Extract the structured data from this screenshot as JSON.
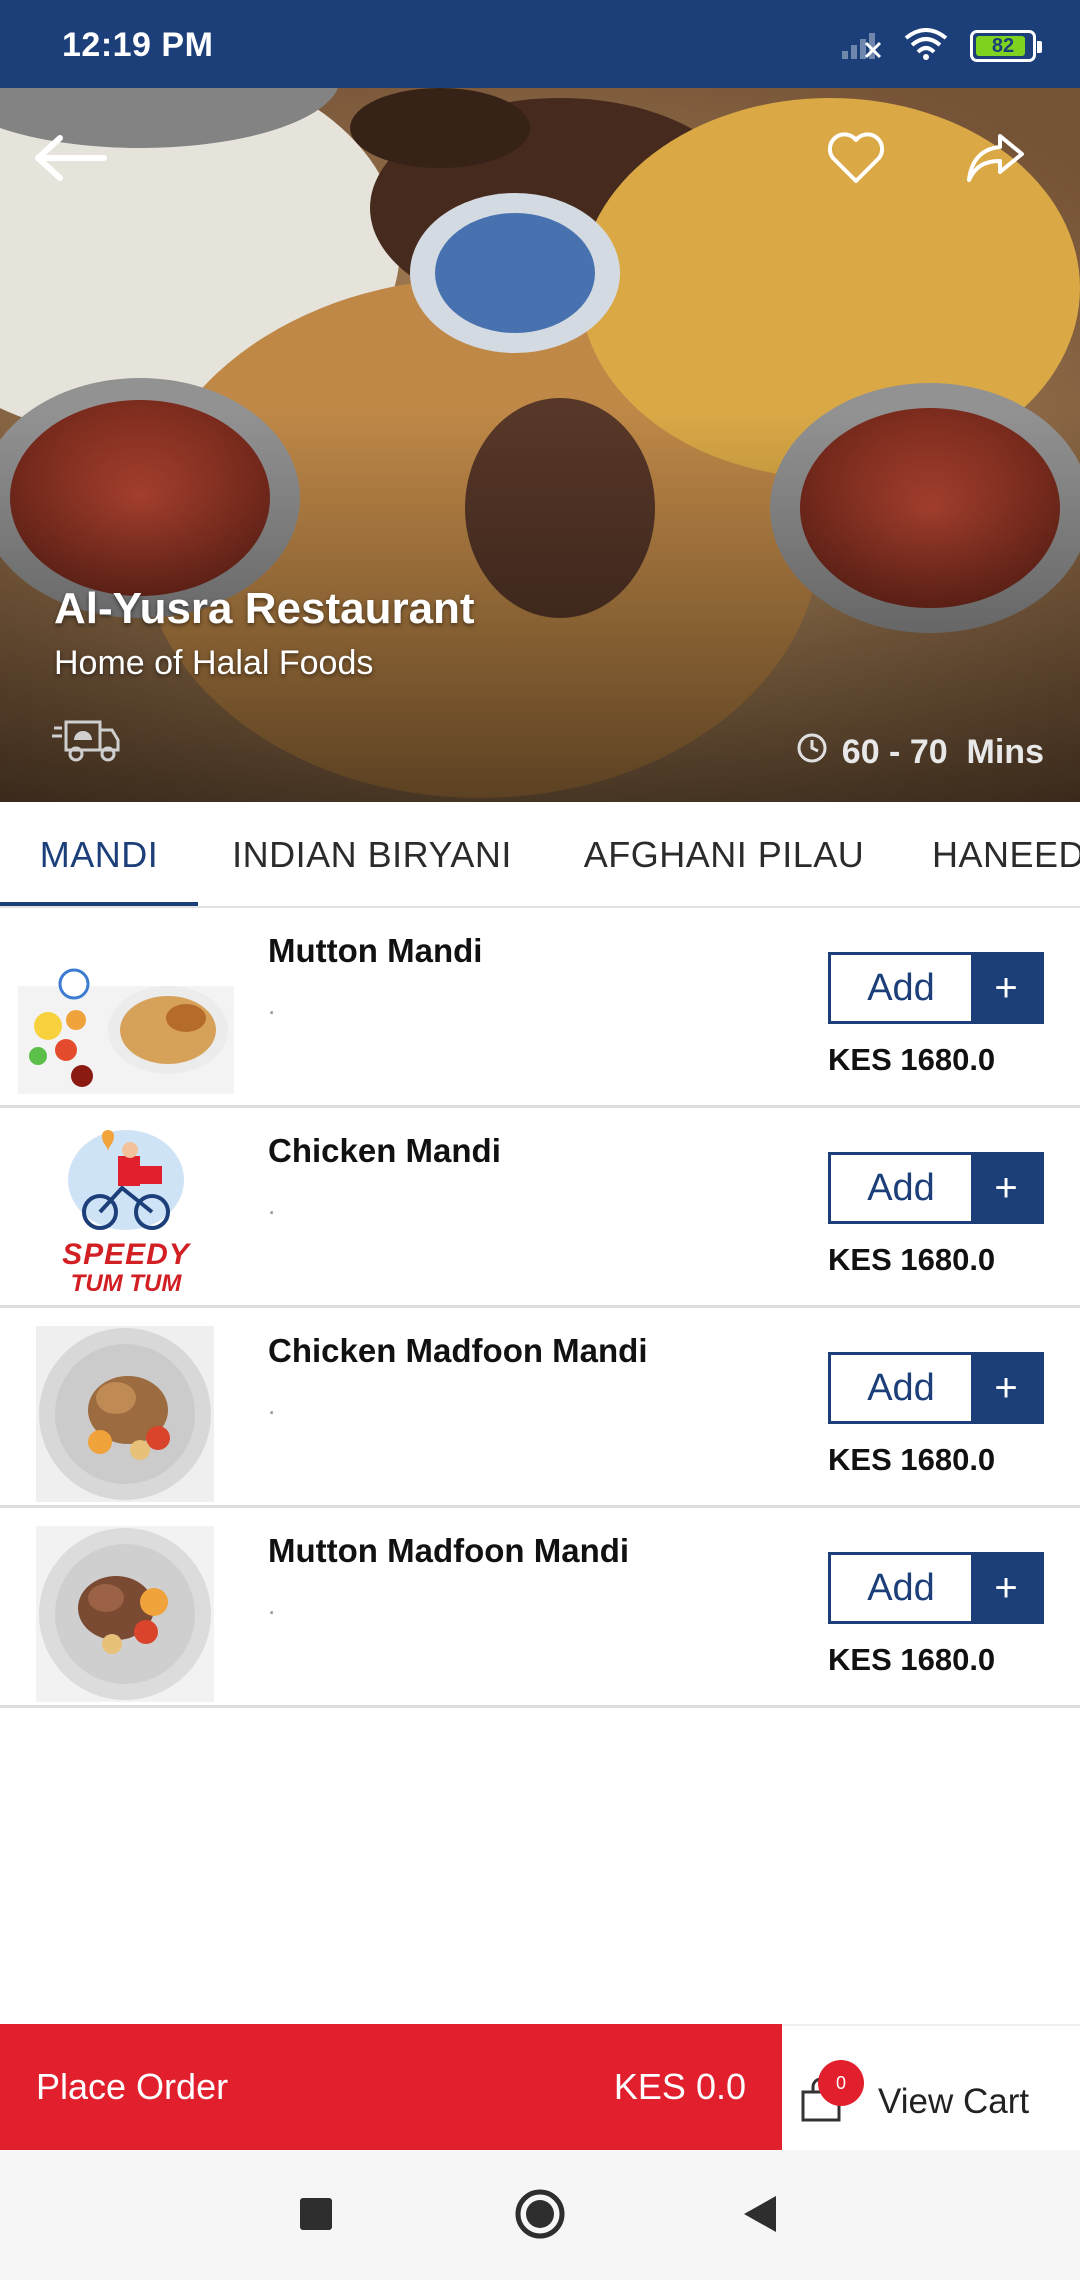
{
  "status_bar": {
    "time": "12:19 PM",
    "battery": "82",
    "icons": [
      "signal-icon",
      "wifi-icon",
      "battery-icon"
    ]
  },
  "restaurant": {
    "name": "Al-Yusra Restaurant",
    "tagline": "Home of Halal Foods",
    "eta": "60 - 70  Mins"
  },
  "header_icons": [
    "back-arrow-icon",
    "heart-icon",
    "share-icon",
    "delivery-icon",
    "clock-icon"
  ],
  "tabs": [
    {
      "label": "MANDI",
      "active": true
    },
    {
      "label": "INDIAN BIRYANI",
      "active": false
    },
    {
      "label": "AFGHANI PILAU",
      "active": false
    },
    {
      "label": "HANEED",
      "active": false
    }
  ],
  "menu_items": [
    {
      "name": "Mutton Mandi",
      "description": ".",
      "price": "KES 1680.0",
      "add_label": "Add",
      "plus": "+"
    },
    {
      "name": "Chicken Mandi",
      "description": ".",
      "price": "KES 1680.0",
      "add_label": "Add",
      "plus": "+"
    },
    {
      "name": "Chicken Madfoon Mandi",
      "description": ".",
      "price": "KES 1680.0",
      "add_label": "Add",
      "plus": "+"
    },
    {
      "name": "Mutton Madfoon Mandi",
      "description": ".",
      "price": "KES 1680.0",
      "add_label": "Add",
      "plus": "+"
    }
  ],
  "thumb_texts": {
    "speedy": "SPEEDY",
    "tumtum": "TUM TUM"
  },
  "order_bar": {
    "place_order_label": "Place Order",
    "total": "KES 0.0",
    "cart_count": "0",
    "view_cart_label": "View Cart"
  },
  "colors": {
    "primary": "#1c3f7a",
    "accent_red": "#e11f2d",
    "battery_green": "#7ed321"
  }
}
